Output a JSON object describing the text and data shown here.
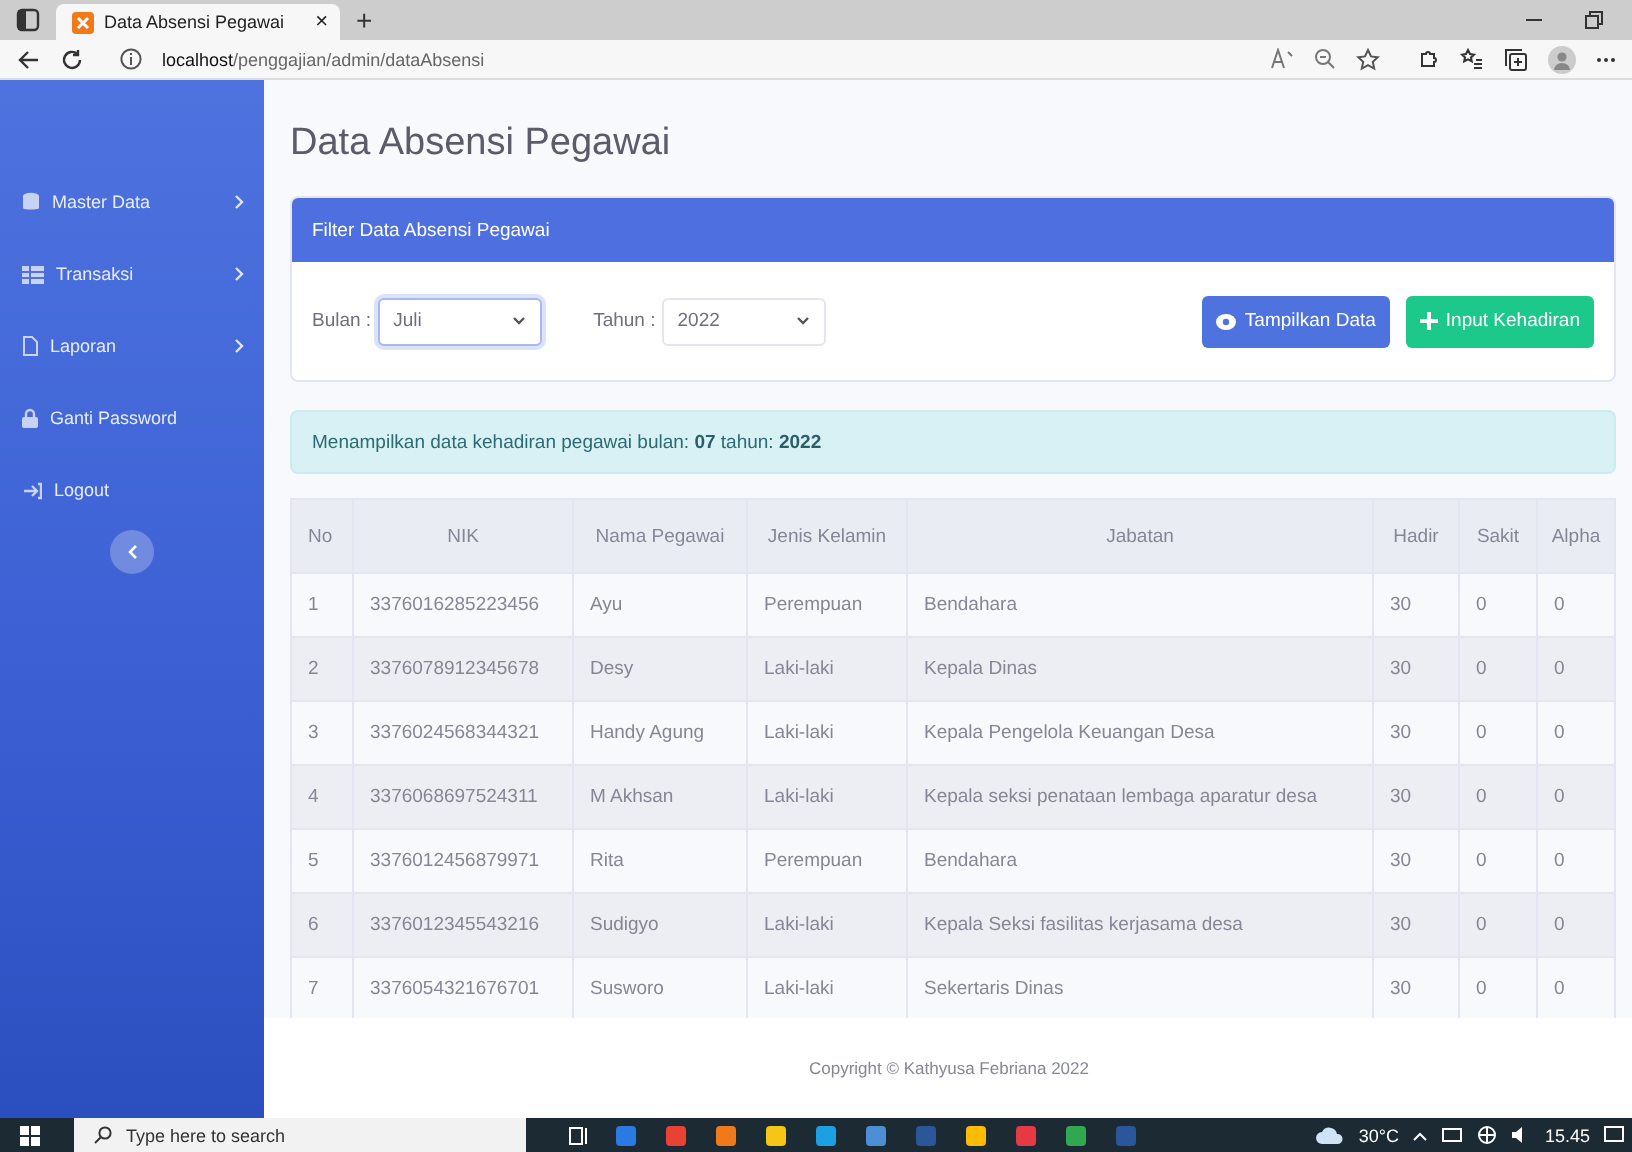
{
  "browser": {
    "tab_title": "Data Absensi Pegawai",
    "tab_close": "×",
    "new_tab": "+",
    "url_host": "localhost",
    "url_path": "/penggajian/admin/dataAbsensi"
  },
  "sidebar": {
    "items": [
      {
        "label": "Master Data",
        "has_submenu": true
      },
      {
        "label": "Transaksi",
        "has_submenu": true
      },
      {
        "label": "Laporan",
        "has_submenu": true
      },
      {
        "label": "Ganti Password",
        "has_submenu": false
      },
      {
        "label": "Logout",
        "has_submenu": false
      }
    ]
  },
  "page_title": "Data Absensi Pegawai",
  "filter": {
    "header": "Filter Data Absensi Pegawai",
    "month_label": "Bulan :",
    "month_value": "Juli",
    "year_label": "Tahun :",
    "year_value": "2022",
    "show_button": "Tampilkan Data",
    "add_button": "Input Kehadiran"
  },
  "alert": "Menampilkan data kehadiran pegawai bulan: **07** tahun: **2022**",
  "table": {
    "columns": [
      "No",
      "NIK",
      "Nama Pegawai",
      "Jenis Kelamin",
      "Jabatan",
      "Hadir",
      "Sakit",
      "Alpha"
    ],
    "rows": [
      [
        "1",
        "3376016285223456",
        "Ayu",
        "Perempuan",
        "Bendahara",
        "30",
        "0",
        "0"
      ],
      [
        "2",
        "3376078912345678",
        "Desy",
        "Laki-laki",
        "Kepala Dinas",
        "30",
        "0",
        "0"
      ],
      [
        "3",
        "3376024568344321",
        "Handy Agung",
        "Laki-laki",
        "Kepala Pengelola Keuangan Desa",
        "30",
        "0",
        "0"
      ],
      [
        "4",
        "3376068697524311",
        "M Akhsan",
        "Laki-laki",
        "Kepala seksi penataan lembaga aparatur desa",
        "30",
        "0",
        "0"
      ],
      [
        "5",
        "3376012456879971",
        "Rita",
        "Perempuan",
        "Bendahara",
        "30",
        "0",
        "0"
      ],
      [
        "6",
        "3376012345543216",
        "Sudigyo",
        "Laki-laki",
        "Kepala Seksi fasilitas kerjasama desa",
        "30",
        "0",
        "0"
      ],
      [
        "7",
        "3376054321676701",
        "Susworo",
        "Laki-laki",
        "Sekertaris Dinas",
        "30",
        "0",
        "0"
      ]
    ]
  },
  "footer": "Copyright © Kathyusa Febriana 2022",
  "taskbar": {
    "search_placeholder": "Type here to search",
    "weather": "30°C",
    "time": "15.45"
  }
}
